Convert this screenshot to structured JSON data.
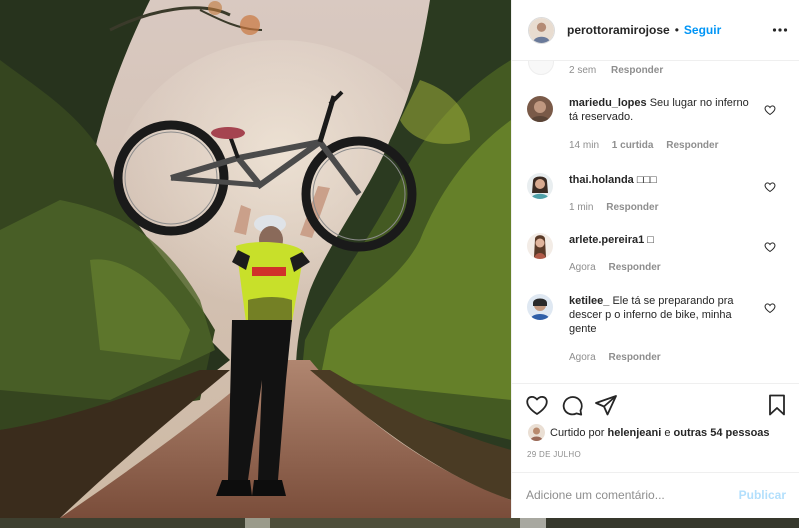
{
  "post": {
    "username": "perottoramirojose",
    "separator": "•",
    "follow_label": "Seguir",
    "more_icon": "more-horizontal-icon",
    "photo": "man-holding-bicycle-overhead-on-forest-road"
  },
  "previous_comment": {
    "time": "2 sem",
    "reply_label": "Responder"
  },
  "comments": [
    {
      "username": "mariedu_lopes",
      "text": "Seu lugar no inferno tá reservado.",
      "time": "14 min",
      "likes": "1 curtida",
      "reply_label": "Responder"
    },
    {
      "username": "thai.holanda",
      "text": "□□□",
      "time": "1 min",
      "likes": "",
      "reply_label": "Responder"
    },
    {
      "username": "arlete.pereira1",
      "text": "□",
      "time": "Agora",
      "likes": "",
      "reply_label": "Responder"
    },
    {
      "username": "ketilee_",
      "text": "Ele tá se preparando pra descer p o inferno de bike, minha gente",
      "time": "Agora",
      "likes": "",
      "reply_label": "Responder"
    }
  ],
  "actions": {
    "like_icon": "heart-icon",
    "comment_icon": "comment-icon",
    "share_icon": "paper-plane-icon",
    "save_icon": "bookmark-icon"
  },
  "likes": {
    "prefix": "Curtido por",
    "user": "helenjeani",
    "conjunction": "e",
    "others": "outras 54 pessoas"
  },
  "date": "29 DE JULHO",
  "add_comment": {
    "placeholder": "Adicione um comentário...",
    "publish_label": "Publicar"
  },
  "colors": {
    "accent": "#0095f6",
    "publish_disabled": "#b2dffc",
    "muted": "#8e8e8e",
    "text": "#262626",
    "border": "#efefef"
  }
}
